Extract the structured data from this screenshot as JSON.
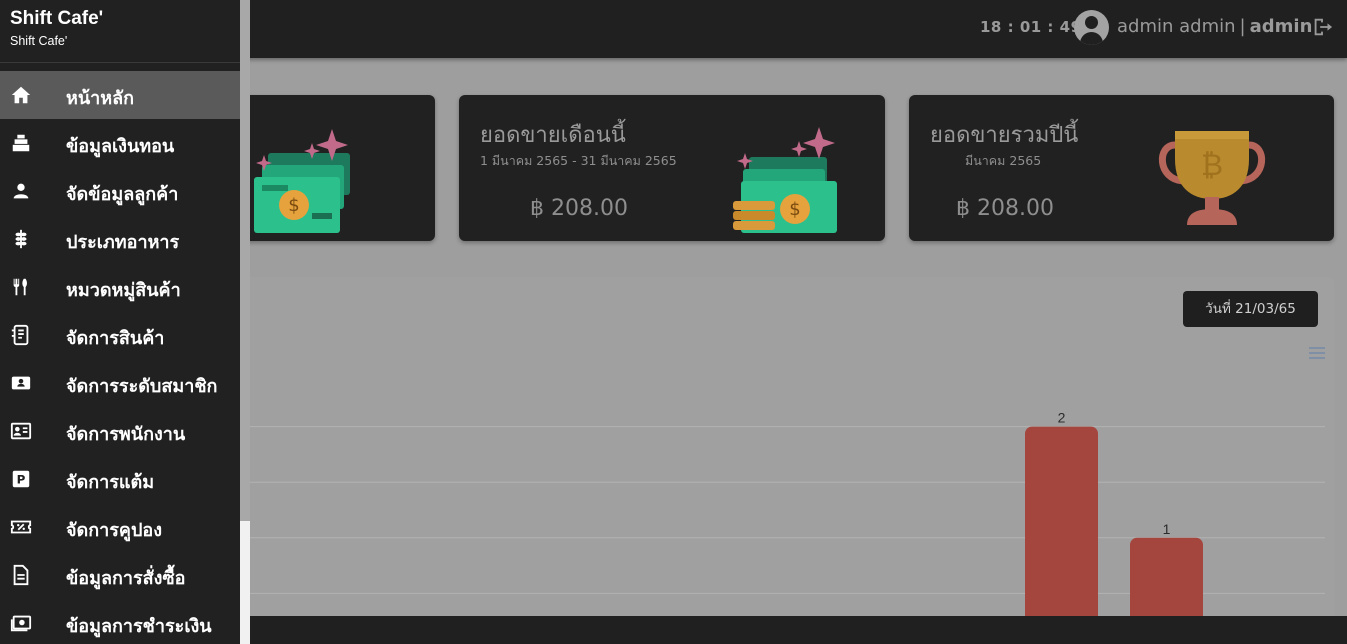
{
  "topbar": {
    "clock": "18 : 01 : 49",
    "user_name": "admin admin",
    "separator": "|",
    "user_role": "admin"
  },
  "sidebar": {
    "brand_title": "Shift Cafe'",
    "brand_subtitle": "Shift Cafe'",
    "items": [
      {
        "label": "หน้าหลัก",
        "icon": "home-icon",
        "active": true
      },
      {
        "label": "ข้อมูลเงินทอน",
        "icon": "cash-register-icon"
      },
      {
        "label": "จัดข้อมูลลูกค้า",
        "icon": "user-icon"
      },
      {
        "label": "ประเภทอาหาร",
        "icon": "wheat-icon"
      },
      {
        "label": "หมวดหมู่สินค้า",
        "icon": "utensils-icon"
      },
      {
        "label": "จัดการสินค้า",
        "icon": "product-box-icon"
      },
      {
        "label": "จัดการระดับสมาชิก",
        "icon": "member-card-icon"
      },
      {
        "label": "จัดการพนักงาน",
        "icon": "id-card-icon"
      },
      {
        "label": "จัดการแต้ม",
        "icon": "points-icon"
      },
      {
        "label": "จัดการคูปอง",
        "icon": "coupon-icon"
      },
      {
        "label": "ข้อมูลการสั่งซื้อ",
        "icon": "document-icon"
      },
      {
        "label": "ข้อมูลการชำระเงิน",
        "icon": "money-icon"
      }
    ]
  },
  "cards": [
    {},
    {
      "title": "ยอดขายเดือนนี้",
      "subtitle": "1 มีนาคม 2565 - 31 มีนาคม 2565",
      "amount": "฿ 208.00"
    },
    {
      "title": "ยอดขายรวมปีนี้",
      "subtitle": "มีนาคม 2565",
      "amount": "฿ 208.00"
    }
  ],
  "panel": {
    "date_badge": "วันที่ 21/03/65"
  },
  "colors": {
    "bar": "#a5463e",
    "sidebar_bg": "#212121",
    "active_item": "#5a5a5a"
  },
  "chart_data": {
    "type": "bar",
    "values": [
      2,
      1
    ],
    "data_labels": [
      "2",
      "1"
    ],
    "ylim": [
      0,
      2.5
    ],
    "grid": true
  }
}
